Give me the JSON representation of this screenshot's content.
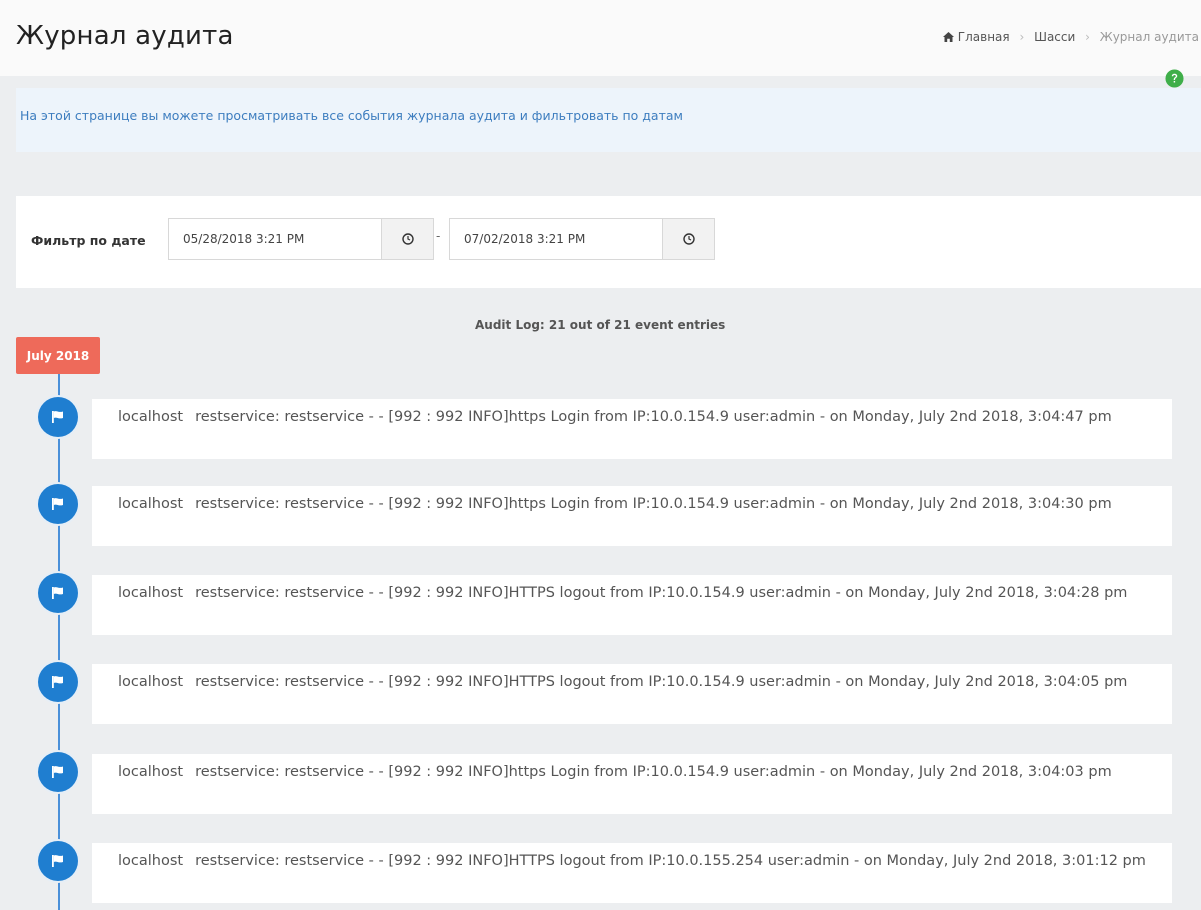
{
  "header": {
    "title": "Журнал аудита",
    "breadcrumb": [
      {
        "label": "Главная",
        "icon": "home-icon"
      },
      {
        "label": "Шасси"
      },
      {
        "label": "Журнал аудита"
      }
    ]
  },
  "info": {
    "text": "На этой странице вы можете просматривать все события журнала аудита и фильтровать по датам"
  },
  "filter": {
    "label": "Фильтр по дате",
    "from_value": "05/28/2018 3:21 PM",
    "separator": "-",
    "to_value": "07/02/2018 3:21 PM"
  },
  "summary": "Audit Log: 21 out of 21 event entries",
  "timeline": {
    "month_badge": "July 2018",
    "entries": [
      {
        "host": "localhost",
        "message": "restservice: restservice - - [992 : 992 INFO]https Login from IP:10.0.154.9 user:admin - on Monday, July 2nd 2018, 3:04:47 pm"
      },
      {
        "host": "localhost",
        "message": "restservice: restservice - - [992 : 992 INFO]https Login from IP:10.0.154.9 user:admin - on Monday, July 2nd 2018, 3:04:30 pm"
      },
      {
        "host": "localhost",
        "message": "restservice: restservice - - [992 : 992 INFO]HTTPS logout from IP:10.0.154.9 user:admin - on Monday, July 2nd 2018, 3:04:28 pm"
      },
      {
        "host": "localhost",
        "message": "restservice: restservice - - [992 : 992 INFO]HTTPS logout from IP:10.0.154.9 user:admin - on Monday, July 2nd 2018, 3:04:05 pm"
      },
      {
        "host": "localhost",
        "message": "restservice: restservice - - [992 : 992 INFO]https Login from IP:10.0.154.9 user:admin - on Monday, July 2nd 2018, 3:04:03 pm"
      },
      {
        "host": "localhost",
        "message": "restservice: restservice - - [992 : 992 INFO]HTTPS logout from IP:10.0.155.254 user:admin - on Monday, July 2nd 2018, 3:01:12 pm"
      }
    ]
  },
  "colors": {
    "accent": "#1f7ed0",
    "badge": "#ee6a5a",
    "info_text": "#3d7dbf",
    "help": "#3fae49"
  }
}
